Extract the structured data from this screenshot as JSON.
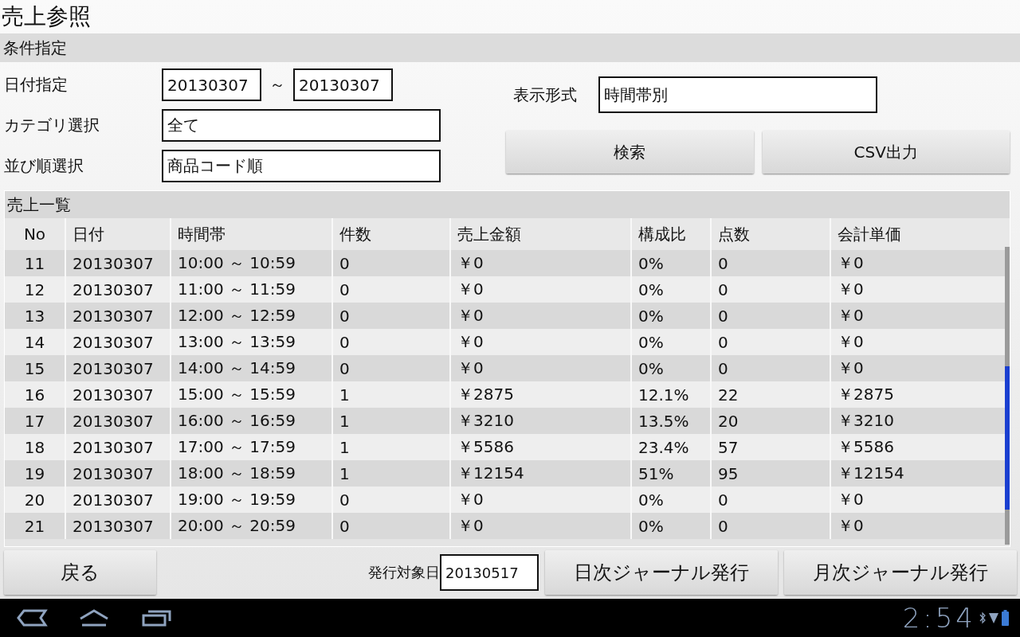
{
  "screen": {
    "title": "売上参照"
  },
  "conditions": {
    "header": "条件指定",
    "date_label": "日付指定",
    "date_from": "20130307",
    "range_separator": "～",
    "date_to": "20130307",
    "category_label": "カテゴリ選択",
    "category": "全て",
    "sort_label": "並び順選択",
    "sort": "商品コード順",
    "display_label": "表示形式",
    "display": "時間帯別",
    "buttons": [
      "検索",
      "CSV出力"
    ]
  },
  "sales_list": {
    "header": "売上一覧",
    "columns": [
      "No",
      "日付",
      "時間帯",
      "件数",
      "売上金額",
      "構成比",
      "点数",
      "会計単価"
    ],
    "rows": [
      [
        "11",
        "20130307",
        "10:00 ～ 10:59",
        "0",
        "￥0",
        "0%",
        "0",
        "￥0"
      ],
      [
        "12",
        "20130307",
        "11:00 ～ 11:59",
        "0",
        "￥0",
        "0%",
        "0",
        "￥0"
      ],
      [
        "13",
        "20130307",
        "12:00 ～ 12:59",
        "0",
        "￥0",
        "0%",
        "0",
        "￥0"
      ],
      [
        "14",
        "20130307",
        "13:00 ～ 13:59",
        "0",
        "￥0",
        "0%",
        "0",
        "￥0"
      ],
      [
        "15",
        "20130307",
        "14:00 ～ 14:59",
        "0",
        "￥0",
        "0%",
        "0",
        "￥0"
      ],
      [
        "16",
        "20130307",
        "15:00 ～ 15:59",
        "1",
        "￥2875",
        "12.1%",
        "22",
        "￥2875"
      ],
      [
        "17",
        "20130307",
        "16:00 ～ 16:59",
        "1",
        "￥3210",
        "13.5%",
        "20",
        "￥3210"
      ],
      [
        "18",
        "20130307",
        "17:00 ～ 17:59",
        "1",
        "￥5586",
        "23.4%",
        "57",
        "￥5586"
      ],
      [
        "19",
        "20130307",
        "18:00 ～ 18:59",
        "1",
        "￥12154",
        "51%",
        "95",
        "￥12154"
      ],
      [
        "20",
        "20130307",
        "19:00 ～ 19:59",
        "0",
        "￥0",
        "0%",
        "0",
        "￥0"
      ],
      [
        "21",
        "20130307",
        "20:00 ～ 20:59",
        "0",
        "￥0",
        "0%",
        "0",
        "￥0"
      ]
    ]
  },
  "footer": {
    "back_button": "戻る",
    "issue_date_label": "発行対象日",
    "issue_date": "20130517",
    "buttons": [
      "日次ジャーナル発行",
      "月次ジャーナル発行"
    ]
  },
  "system_bar": {
    "time": "2:54"
  }
}
